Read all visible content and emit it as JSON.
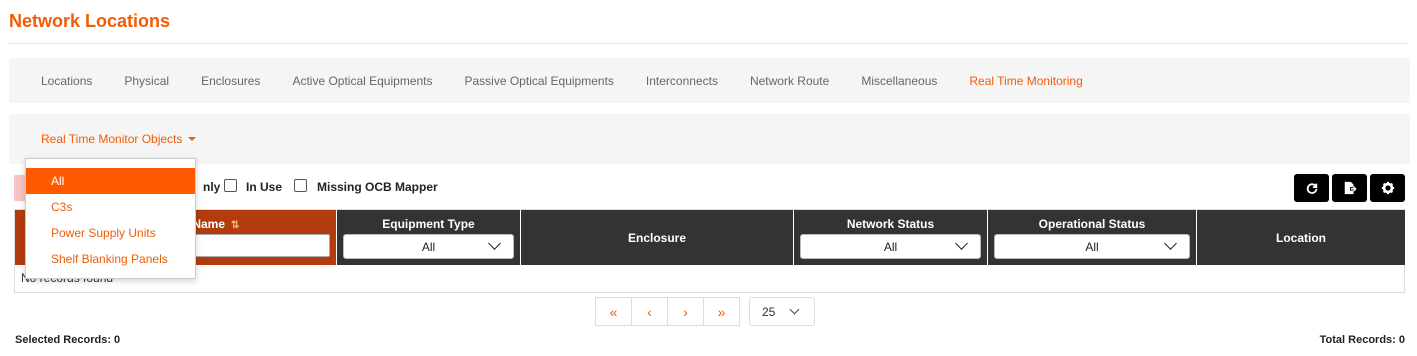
{
  "page": {
    "title": "Network Locations"
  },
  "nav": {
    "tabs": [
      {
        "label": "Locations"
      },
      {
        "label": "Physical"
      },
      {
        "label": "Enclosures"
      },
      {
        "label": "Active Optical Equipments"
      },
      {
        "label": "Passive Optical Equipments"
      },
      {
        "label": "Interconnects"
      },
      {
        "label": "Network Route"
      },
      {
        "label": "Miscellaneous"
      },
      {
        "label": "Real Time Monitoring",
        "active": true
      }
    ]
  },
  "subnav": {
    "dropdown_label": "Real Time Monitor Objects"
  },
  "dropdown_menu": {
    "items": [
      {
        "label": "All",
        "selected": true
      },
      {
        "label": "C3s"
      },
      {
        "label": "Power Supply Units"
      },
      {
        "label": "Shelf Blanking Panels"
      }
    ]
  },
  "filters": {
    "partial_label": "nly",
    "in_use": "In Use",
    "missing_ocb_mapper": "Missing OCB Mapper"
  },
  "toolbar": {
    "refresh_icon": "refresh-icon",
    "export_icon": "export-icon",
    "settings_icon": "gear-icon"
  },
  "table": {
    "columns": {
      "display_name": "play Name",
      "equipment_type": "Equipment Type",
      "enclosure": "Enclosure",
      "network_status": "Network Status",
      "operational_status": "Operational Status",
      "location": "Location"
    },
    "filters": {
      "equipment_type": "All",
      "network_status": "All",
      "operational_status": "All"
    },
    "empty_text": "No records found",
    "sort_icon": "sort-ascending-icon"
  },
  "pagination": {
    "first": "«",
    "prev": "‹",
    "next": "›",
    "last": "»",
    "page_size": "25"
  },
  "footer": {
    "selected": "Selected Records: 0",
    "total": "Total Records: 0"
  },
  "colors": {
    "accent": "#f25c05",
    "sorted_header": "#b33c0f",
    "header_bg": "#333333"
  }
}
